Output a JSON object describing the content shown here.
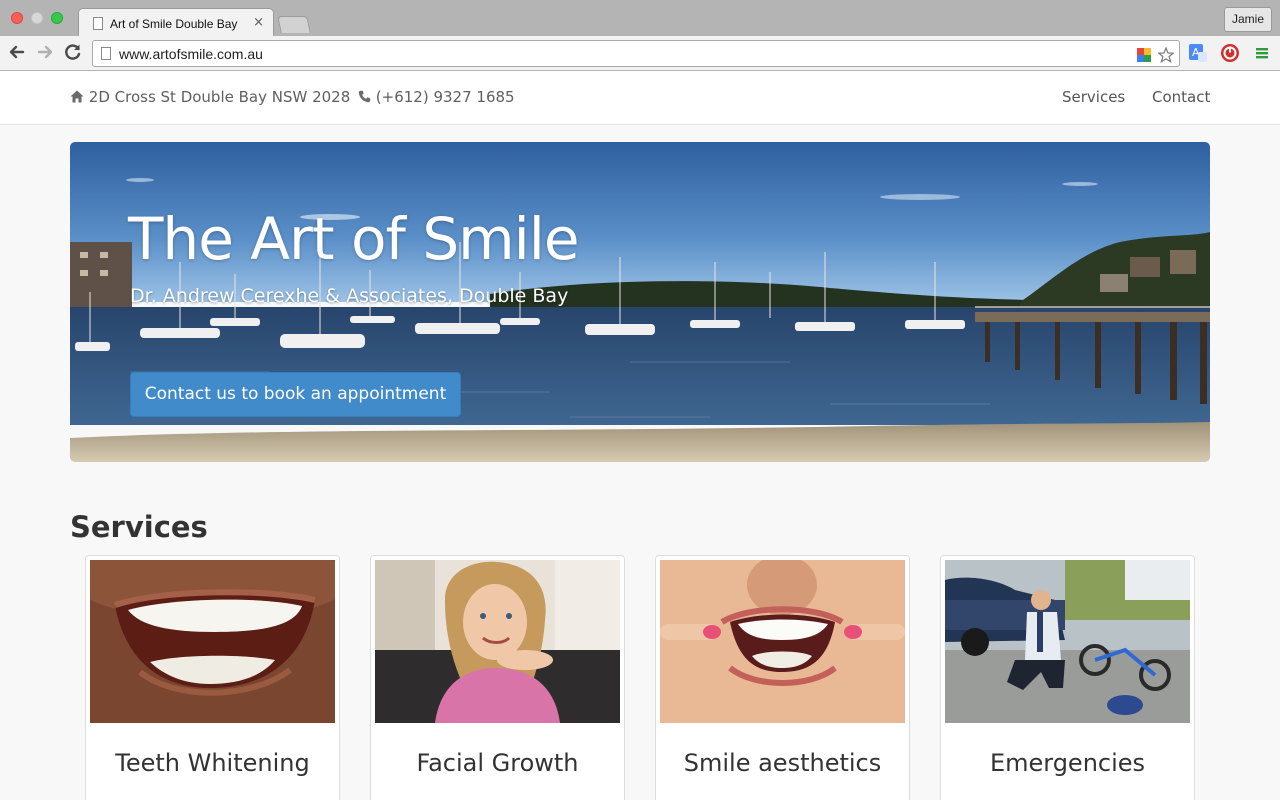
{
  "browser": {
    "tab_title": "Art of Smile Double Bay",
    "tab_close": "×",
    "url": "www.artofsmile.com.au",
    "profile_name": "Jamie"
  },
  "topbar": {
    "address": "2D Cross St Double Bay NSW 2028",
    "phone": "(+612) 9327 1685",
    "nav": [
      "Services",
      "Contact"
    ]
  },
  "hero": {
    "title": "The Art of Smile",
    "subtitle": "Dr. Andrew Cerexhe & Associates, Double Bay",
    "cta_label": "Contact us to book an appointment"
  },
  "services": {
    "heading": "Services",
    "cards": [
      {
        "label": "Teeth Whitening",
        "image": "smiling-mouth-photo"
      },
      {
        "label": "Facial Growth",
        "image": "girl-smiling-photo"
      },
      {
        "label": "Smile aesthetics",
        "image": "smile-fingers-photo"
      },
      {
        "label": "Emergencies",
        "image": "bike-accident-photo"
      }
    ]
  },
  "colors": {
    "primary_button": "#428bca",
    "page_background": "#f8f8f8",
    "text_muted": "#5f5f5f"
  }
}
